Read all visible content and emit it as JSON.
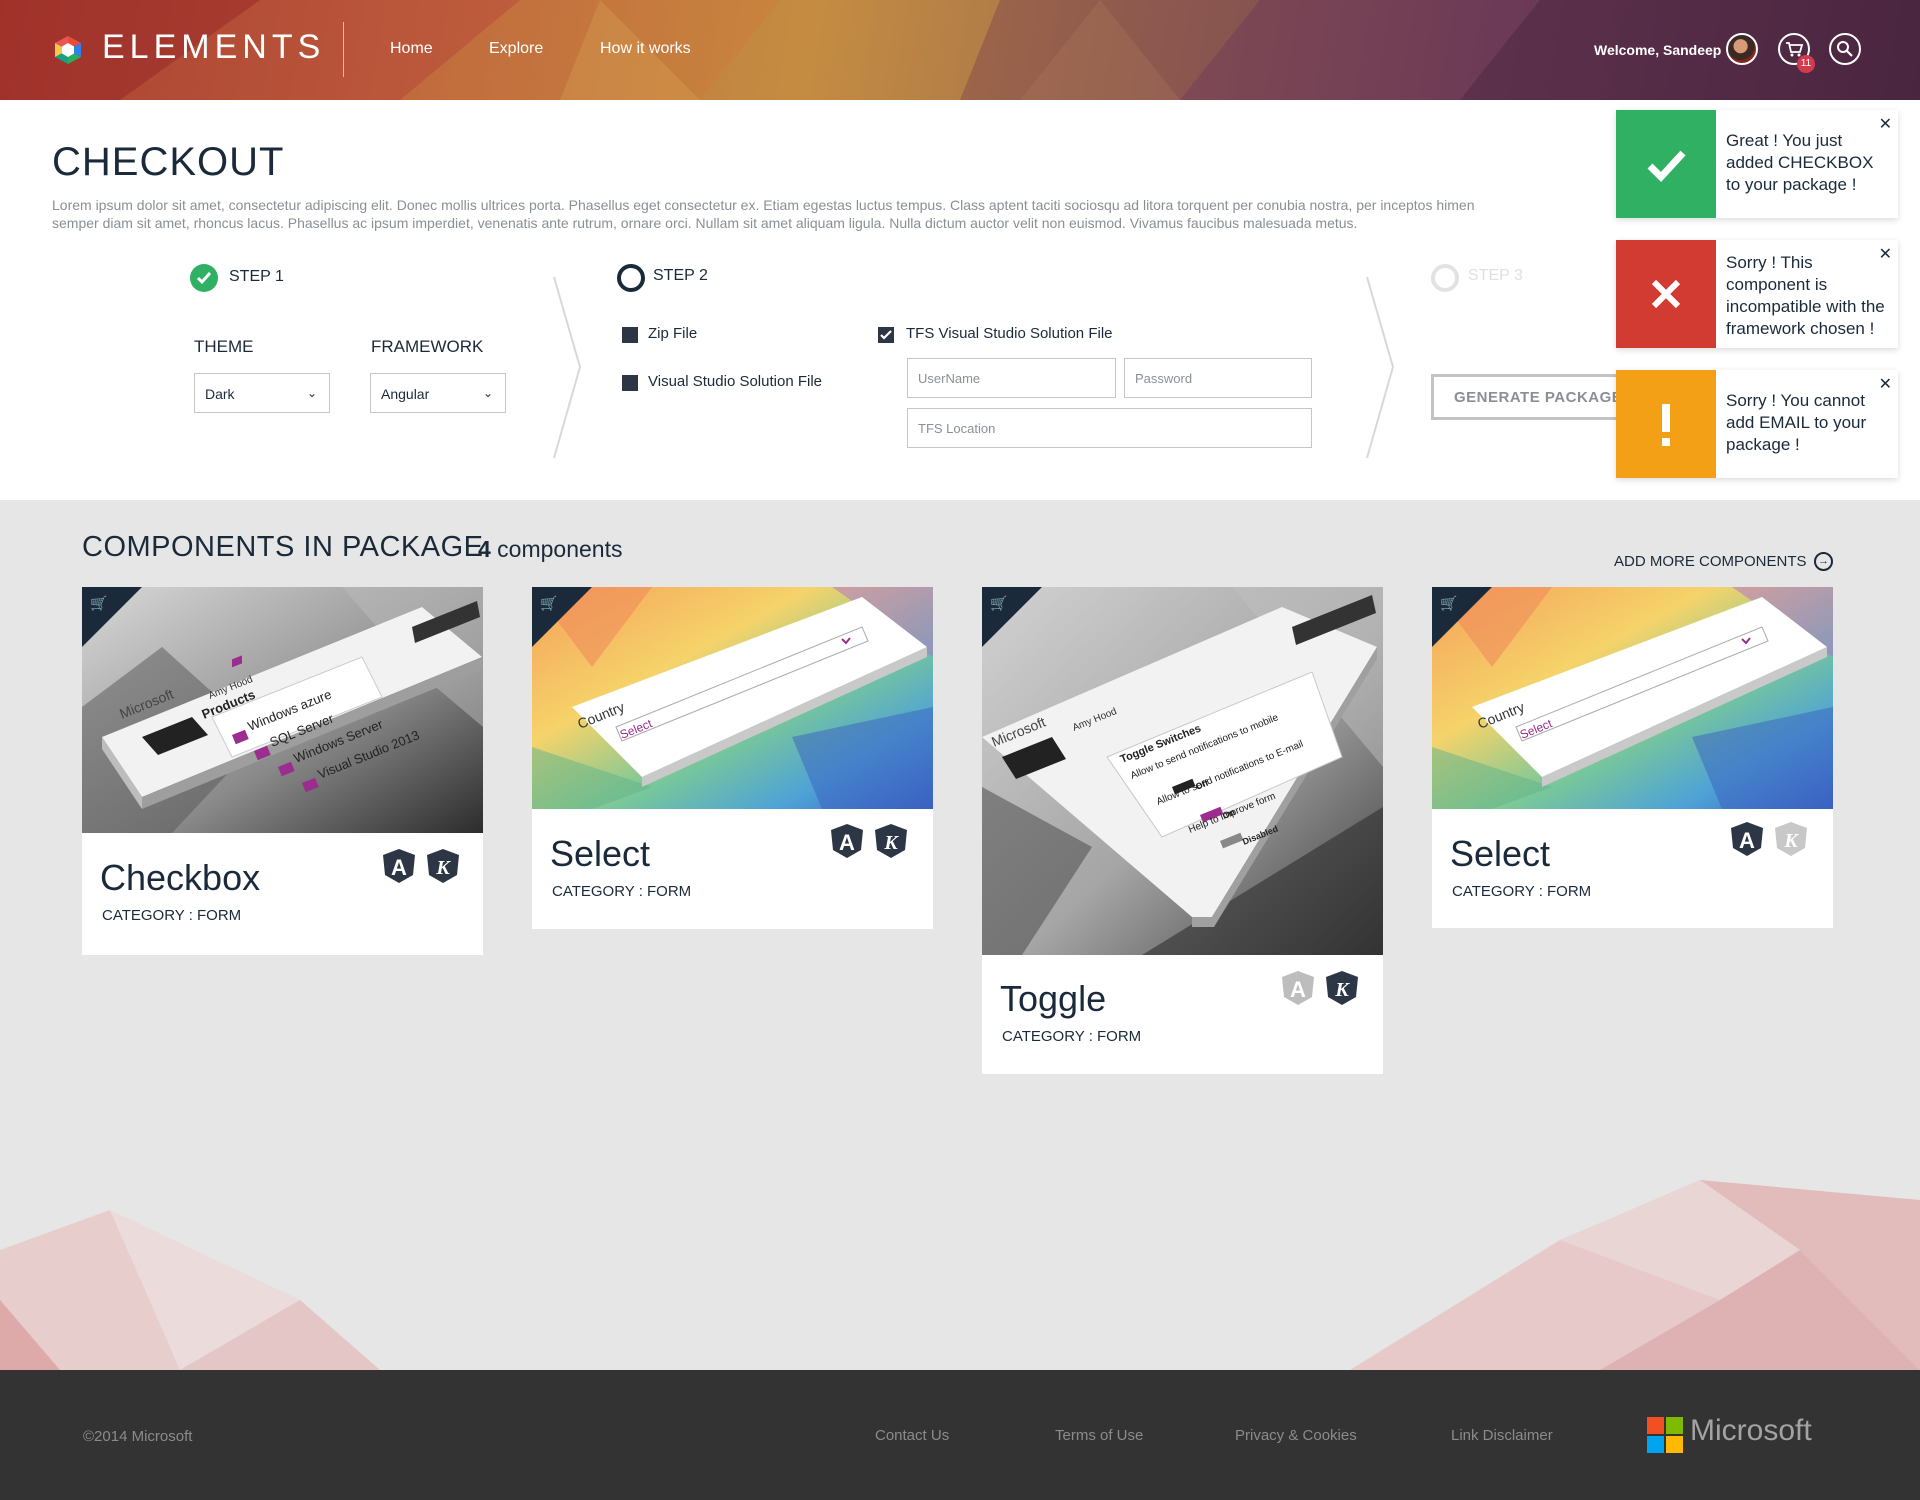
{
  "header": {
    "brand": "ELEMENTS",
    "nav": [
      "Home",
      "Explore",
      "How it works"
    ],
    "welcome": "Welcome, Sandeep",
    "cart_count": "11"
  },
  "checkout": {
    "title": "CHECKOUT",
    "description_line1": "Lorem ipsum dolor sit amet, consectetur adipiscing elit. Donec mollis ultrices porta. Phasellus eget consectetur ex. Etiam egestas luctus tempus. Class aptent taciti sociosqu ad litora torquent per conubia nostra, per inceptos himen",
    "description_line2": "semper diam sit amet, rhoncus lacus. Phasellus ac ipsum imperdiet, venenatis ante rutrum, ornare orci. Nullam sit amet aliquam ligula. Nulla dictum auctor velit non euismod. Vivamus faucibus malesuada metus.",
    "step1": {
      "label": "STEP 1",
      "theme_label": "THEME",
      "theme_value": "Dark",
      "framework_label": "FRAMEWORK",
      "framework_value": "Angular"
    },
    "step2": {
      "label": "STEP 2",
      "options": [
        "Zip File",
        "Visual Studio Solution File",
        "TFS Visual Studio Solution File"
      ],
      "username_placeholder": "UserName",
      "password_placeholder": "Password",
      "tfs_placeholder": "TFS Location"
    },
    "step3": {
      "label": "STEP 3",
      "button": "GENERATE PACKAGE"
    }
  },
  "toasts": [
    {
      "type": "success",
      "message": "Great ! You just added CHECKBOX to your package !",
      "color": "#2fb062"
    },
    {
      "type": "error",
      "message": "Sorry ! This component is incompatible with the framework chosen !",
      "color": "#d13b32"
    },
    {
      "type": "warning",
      "message": "Sorry ! You cannot add EMAIL to your package !",
      "color": "#f4a017"
    }
  ],
  "components": {
    "title": "COMPONENTS IN PACKAGE",
    "count": "4",
    "count_suffix": " components",
    "add_more": "ADD MORE COMPONENTS",
    "cards": [
      {
        "name": "Checkbox",
        "category": "CATEGORY : FORM"
      },
      {
        "name": "Select",
        "category": "CATEGORY : FORM"
      },
      {
        "name": "Toggle",
        "category": "CATEGORY : FORM"
      },
      {
        "name": "Select",
        "category": "CATEGORY : FORM"
      }
    ],
    "thumb_text": {
      "microsoft": "Microsoft",
      "amy": "Amy Hood",
      "products": "Products",
      "p1": "Windows azure",
      "p2": "SQL Server",
      "p3": "Windows Server",
      "p4": "Visual Studio 2013",
      "country": "Country",
      "select": "Select",
      "toggle_title": "Toggle Switches",
      "t1": "Allow to send notifications to mobile",
      "t2": "Allow to send notifications to E-mail",
      "t3": "Help to improve form",
      "off": "Off",
      "on": "On",
      "disabled": "Disabled"
    }
  },
  "footer": {
    "copyright": "©2014 Microsoft",
    "links": [
      "Contact Us",
      "Terms of Use",
      "Privacy & Cookies",
      "Link Disclaimer"
    ],
    "brand": "Microsoft"
  },
  "colors": {
    "accent_dark": "#1b2a3a",
    "success": "#2fb062",
    "error": "#d13b32",
    "warning": "#f4a017",
    "footer_bg": "#333334"
  }
}
